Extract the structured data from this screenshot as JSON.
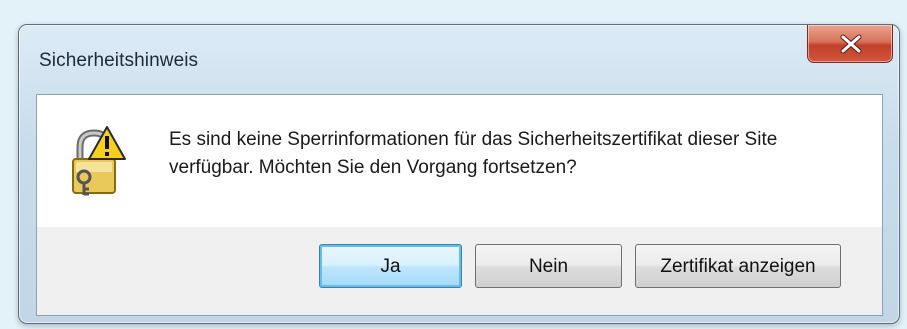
{
  "window": {
    "title": "Sicherheitshinweis"
  },
  "dialog": {
    "icon": "security-warning-icon",
    "message_line1": "Es sind keine Sperrinformationen für das Sicherheitszertifikat dieser Site",
    "message_line2": "verfügbar. Möchten Sie den Vorgang fortsetzen?"
  },
  "buttons": {
    "yes_label": "Ja",
    "no_label": "Nein",
    "view_certificate_label": "Zertifikat anzeigen"
  },
  "colors": {
    "background": "#e3f2f9",
    "close_button": "#c2402a",
    "default_button_border": "#3c7fb1"
  }
}
